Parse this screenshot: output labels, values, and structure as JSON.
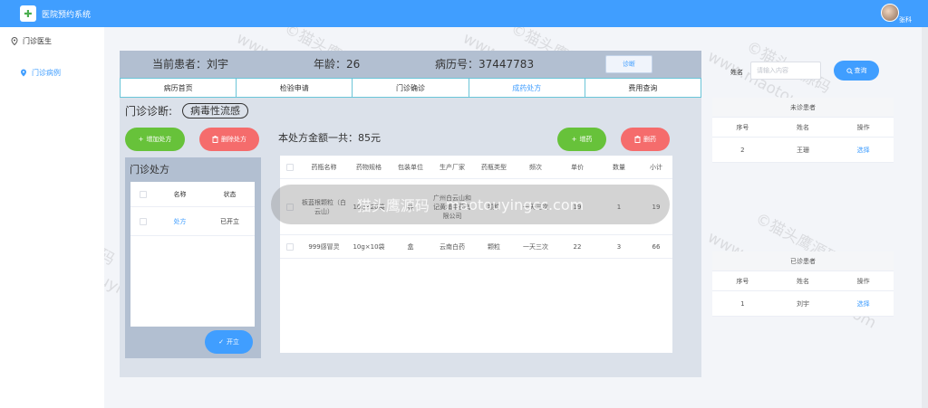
{
  "app": {
    "title": "医院预约系统",
    "user_name": "张科"
  },
  "sidebar": {
    "items": [
      {
        "label": "门诊医生"
      },
      {
        "label": "门诊病例"
      }
    ]
  },
  "patient": {
    "current_label": "当前患者：刘宇",
    "age_label": "年龄：26",
    "record_label": "病历号：37447783",
    "diagnose_button": "诊断"
  },
  "tabs": [
    {
      "label": "病历首页"
    },
    {
      "label": "检验申请"
    },
    {
      "label": "门诊确诊"
    },
    {
      "label": "成药处方"
    },
    {
      "label": "费用查询"
    }
  ],
  "diagnosis": {
    "label": "门诊诊断:",
    "value": "病毒性流感"
  },
  "buttons": {
    "add_rx": "增加处方",
    "delete_rx": "删除处方",
    "add_drug": "增药",
    "delete_drug": "删药",
    "issue": "开立"
  },
  "total_label": "本处方金额一共：85元",
  "rx_panel": {
    "title": "门诊处方",
    "headers": [
      "名称",
      "状态"
    ],
    "rows": [
      {
        "name": "处方",
        "status": "已开立"
      }
    ]
  },
  "med_table": {
    "headers": [
      "药瓶名称",
      "药物规格",
      "包装单位",
      "生产厂家",
      "药瓶类型",
      "频次",
      "单价",
      "数量",
      "小计"
    ],
    "rows": [
      {
        "name": "板蓝根颗粒（白云山）",
        "spec": "10g×20袋",
        "unit": "袋",
        "maker": "广州白云山和记黄埔中药有限公司",
        "type": "颗粒",
        "freq": "一天三次",
        "price": "19",
        "qty": "1",
        "subtotal": "19"
      },
      {
        "name": "999感冒灵",
        "spec": "10g×10袋",
        "unit": "盒",
        "maker": "云南白药",
        "type": "颗粒",
        "freq": "一天三次",
        "price": "22",
        "qty": "3",
        "subtotal": "66"
      }
    ]
  },
  "overlay": {
    "left": "猫头鹰源码",
    "right": "maotouyingcc.com"
  },
  "search": {
    "label": "姓名",
    "placeholder": "请输入内容",
    "button": "查询"
  },
  "waiting": {
    "title": "未诊患者",
    "headers": [
      "序号",
      "姓名",
      "操作"
    ],
    "rows": [
      {
        "no": "2",
        "name": "王珊",
        "action": "选择"
      }
    ]
  },
  "done": {
    "title": "已诊患者",
    "headers": [
      "序号",
      "姓名",
      "操作"
    ],
    "rows": [
      {
        "no": "1",
        "name": "刘宇",
        "action": "选择"
      }
    ]
  },
  "watermark": {
    "cn": "©猫头鹰源码",
    "en": "www.maotouyingcc.com"
  }
}
